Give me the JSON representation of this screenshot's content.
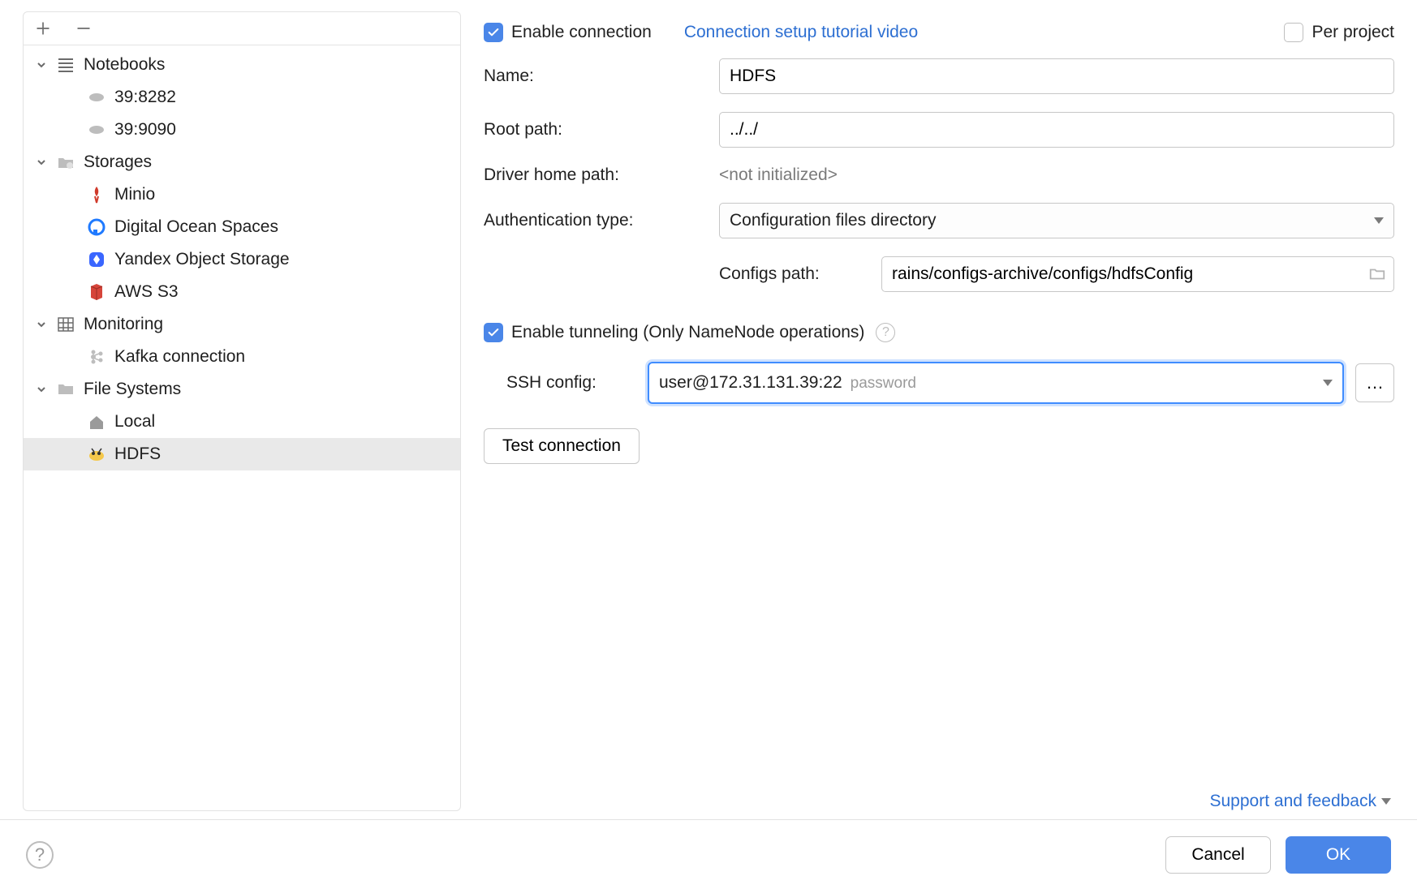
{
  "header": {
    "enable_connection_label": "Enable connection",
    "enable_connection_checked": true,
    "tutorial_link": "Connection setup tutorial video",
    "per_project_label": "Per project",
    "per_project_checked": false
  },
  "form": {
    "name_label": "Name:",
    "name_value": "HDFS",
    "root_path_label": "Root path:",
    "root_path_value": "../../",
    "driver_home_label": "Driver home path:",
    "driver_home_value": "<not initialized>",
    "auth_type_label": "Authentication type:",
    "auth_type_value": "Configuration files directory",
    "configs_path_label": "Configs path:",
    "configs_path_value": "rains/configs-archive/configs/hdfsConfig",
    "tunneling_label": "Enable tunneling (Only NameNode operations)",
    "tunneling_checked": true,
    "ssh_config_label": "SSH config:",
    "ssh_config_value": "user@172.31.131.39:22",
    "ssh_config_hint": "password",
    "test_connection_label": "Test connection"
  },
  "footer": {
    "support_link": "Support and feedback",
    "cancel": "Cancel",
    "ok": "OK"
  },
  "sidebar": {
    "groups": [
      {
        "label": "Notebooks",
        "icon": "lines-icon",
        "expanded": true,
        "items": [
          {
            "label": "39:8282",
            "icon": "zeppelin-icon"
          },
          {
            "label": "39:9090",
            "icon": "zeppelin-icon"
          }
        ]
      },
      {
        "label": "Storages",
        "icon": "folder-cloud-icon",
        "expanded": true,
        "items": [
          {
            "label": "Minio",
            "icon": "minio-icon"
          },
          {
            "label": "Digital Ocean Spaces",
            "icon": "digitalocean-icon"
          },
          {
            "label": "Yandex Object Storage",
            "icon": "yandex-icon"
          },
          {
            "label": "AWS S3",
            "icon": "aws-s3-icon"
          }
        ]
      },
      {
        "label": "Monitoring",
        "icon": "grid-icon",
        "expanded": true,
        "items": [
          {
            "label": "Kafka connection",
            "icon": "kafka-icon"
          }
        ]
      },
      {
        "label": "File Systems",
        "icon": "folder-icon",
        "expanded": true,
        "items": [
          {
            "label": "Local",
            "icon": "home-icon"
          },
          {
            "label": "HDFS",
            "icon": "hadoop-icon",
            "selected": true
          }
        ]
      }
    ]
  }
}
